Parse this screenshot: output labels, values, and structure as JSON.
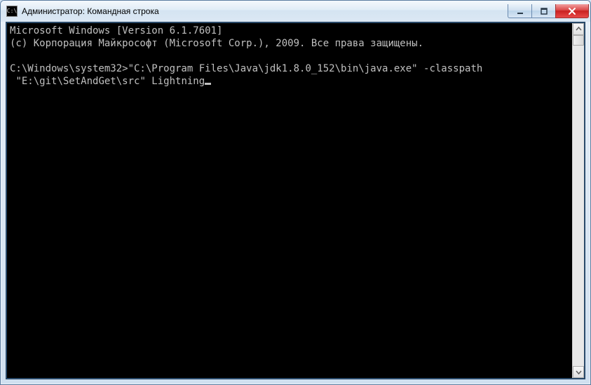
{
  "window": {
    "title": "Администратор: Командная строка"
  },
  "terminal": {
    "line1": "Microsoft Windows [Version 6.1.7601]",
    "line2": "(c) Корпорация Майкрософт (Microsoft Corp.), 2009. Все права защищены.",
    "blank": "",
    "prompt": "C:\\Windows\\system32>",
    "command_part1": "\"C:\\Program Files\\Java\\jdk1.8.0_152\\bin\\java.exe\" -classpath",
    "command_part2": " \"E:\\git\\SetAndGet\\src\" Lightning"
  }
}
